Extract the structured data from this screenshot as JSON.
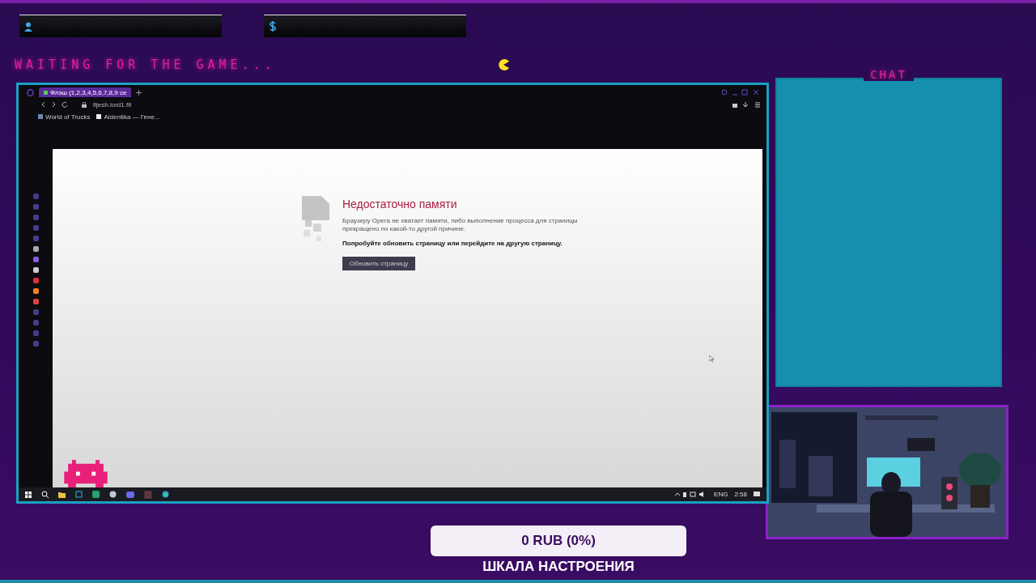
{
  "top_bars": [
    {
      "kind": "user"
    },
    {
      "kind": "donation"
    }
  ],
  "status_text": "WAITING FOR THE GAME...",
  "browser": {
    "tab_title": "Флэш (1,2,3,4,5,6,7,8,9 се",
    "address": "fljesh.lord1.fit",
    "bookmarks": [
      "World of Trucks",
      "Aldentika — Гене..."
    ],
    "error": {
      "title": "Недостаточно памяти",
      "message": "Браузеру Opera не хватает памяти, либо выполнение процесса для страницы прекращено по какой-то другой причине.",
      "hint": "Попробуйте обновить страницу или перейдите на другую страницу.",
      "button": "Обновить страницу"
    }
  },
  "taskbar": {
    "language": "ENG",
    "time": "2:58"
  },
  "chat": {
    "title": "CHAT"
  },
  "goal": {
    "label": "0 RUB (0%)",
    "level": 0,
    "caption": "ШКАЛА НАСТРОЕНИЯ"
  }
}
